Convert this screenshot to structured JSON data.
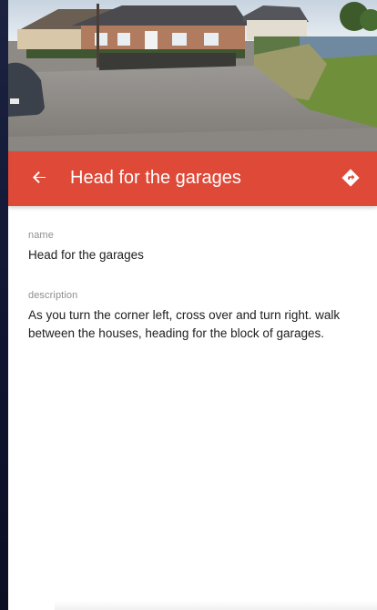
{
  "app_bar": {
    "title": "Head for the garages",
    "back_icon": "arrow-back-icon",
    "directions_icon": "directions-icon",
    "color": "#df4937"
  },
  "photo": {
    "icon": "street-photo"
  },
  "fields": {
    "name": {
      "label": "name",
      "value": "Head for the garages"
    },
    "description": {
      "label": "description",
      "value": "As you turn the corner left, cross over and turn right. walk between the houses, heading for the block of garages."
    }
  }
}
